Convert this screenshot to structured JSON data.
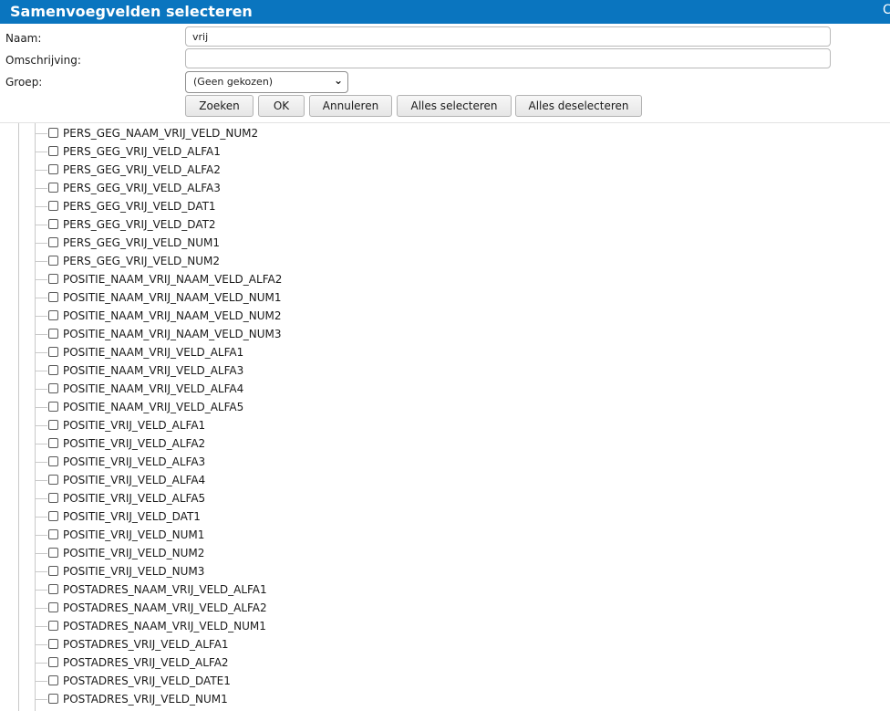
{
  "dialog": {
    "title": "Samenvoegvelden selecteren",
    "close_glyph": "C"
  },
  "form": {
    "naam_label": "Naam:",
    "naam_value": "vrij",
    "omschrijving_label": "Omschrijving:",
    "omschrijving_value": "",
    "groep_label": "Groep:",
    "groep_selected": "(Geen gekozen)"
  },
  "buttons": {
    "zoeken": "Zoeken",
    "ok": "OK",
    "annuleren": "Annuleren",
    "alles_selecteren": "Alles selecteren",
    "alles_deselecteren": "Alles deselecteren"
  },
  "fields": [
    {
      "label": "PERS_GEG_NAAM_VRIJ_VELD_NUM2",
      "checked": false
    },
    {
      "label": "PERS_GEG_VRIJ_VELD_ALFA1",
      "checked": false
    },
    {
      "label": "PERS_GEG_VRIJ_VELD_ALFA2",
      "checked": false
    },
    {
      "label": "PERS_GEG_VRIJ_VELD_ALFA3",
      "checked": false
    },
    {
      "label": "PERS_GEG_VRIJ_VELD_DAT1",
      "checked": false
    },
    {
      "label": "PERS_GEG_VRIJ_VELD_DAT2",
      "checked": false
    },
    {
      "label": "PERS_GEG_VRIJ_VELD_NUM1",
      "checked": false
    },
    {
      "label": "PERS_GEG_VRIJ_VELD_NUM2",
      "checked": false
    },
    {
      "label": "POSITIE_NAAM_VRIJ_NAAM_VELD_ALFA2",
      "checked": false
    },
    {
      "label": "POSITIE_NAAM_VRIJ_NAAM_VELD_NUM1",
      "checked": false
    },
    {
      "label": "POSITIE_NAAM_VRIJ_NAAM_VELD_NUM2",
      "checked": false
    },
    {
      "label": "POSITIE_NAAM_VRIJ_NAAM_VELD_NUM3",
      "checked": false
    },
    {
      "label": "POSITIE_NAAM_VRIJ_VELD_ALFA1",
      "checked": false
    },
    {
      "label": "POSITIE_NAAM_VRIJ_VELD_ALFA3",
      "checked": false
    },
    {
      "label": "POSITIE_NAAM_VRIJ_VELD_ALFA4",
      "checked": false
    },
    {
      "label": "POSITIE_NAAM_VRIJ_VELD_ALFA5",
      "checked": false
    },
    {
      "label": "POSITIE_VRIJ_VELD_ALFA1",
      "checked": false
    },
    {
      "label": "POSITIE_VRIJ_VELD_ALFA2",
      "checked": false
    },
    {
      "label": "POSITIE_VRIJ_VELD_ALFA3",
      "checked": false
    },
    {
      "label": "POSITIE_VRIJ_VELD_ALFA4",
      "checked": false
    },
    {
      "label": "POSITIE_VRIJ_VELD_ALFA5",
      "checked": false
    },
    {
      "label": "POSITIE_VRIJ_VELD_DAT1",
      "checked": false
    },
    {
      "label": "POSITIE_VRIJ_VELD_NUM1",
      "checked": false
    },
    {
      "label": "POSITIE_VRIJ_VELD_NUM2",
      "checked": false
    },
    {
      "label": "POSITIE_VRIJ_VELD_NUM3",
      "checked": false
    },
    {
      "label": "POSTADRES_NAAM_VRIJ_VELD_ALFA1",
      "checked": false
    },
    {
      "label": "POSTADRES_NAAM_VRIJ_VELD_ALFA2",
      "checked": false
    },
    {
      "label": "POSTADRES_NAAM_VRIJ_VELD_NUM1",
      "checked": false
    },
    {
      "label": "POSTADRES_VRIJ_VELD_ALFA1",
      "checked": false
    },
    {
      "label": "POSTADRES_VRIJ_VELD_ALFA2",
      "checked": false
    },
    {
      "label": "POSTADRES_VRIJ_VELD_DATE1",
      "checked": false
    },
    {
      "label": "POSTADRES_VRIJ_VELD_NUM1",
      "checked": false
    }
  ],
  "colors": {
    "titlebar": "#0a75bf",
    "title_text": "#ffffff"
  }
}
